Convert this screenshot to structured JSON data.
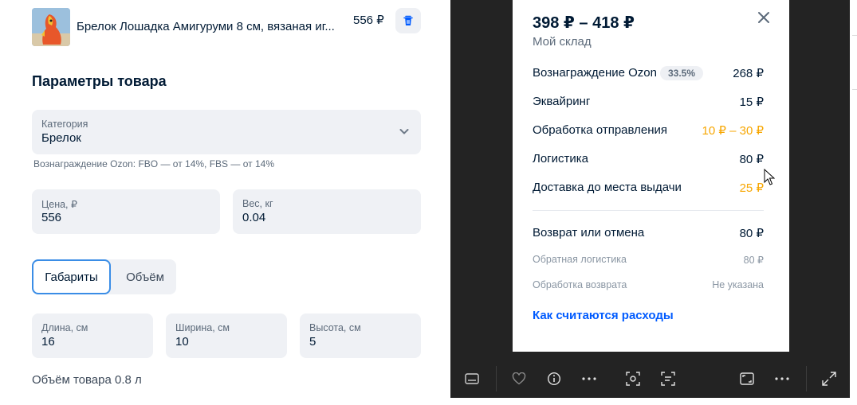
{
  "product": {
    "name": "Брелок Лошадка Амигуруми 8 см, вязаная иг...",
    "price": "556 ₽"
  },
  "section_title": "Параметры товара",
  "category": {
    "label": "Категория",
    "value": "Брелок",
    "hint": "Вознаграждение Ozon: FBO — от 14%, FBS — от 14%"
  },
  "price_field": {
    "label": "Цена, ₽",
    "value": "556"
  },
  "weight_field": {
    "label": "Вес, кг",
    "value": "0.04"
  },
  "tabs": {
    "dimensions": "Габариты",
    "volume": "Объём",
    "active": "dimensions"
  },
  "length_field": {
    "label": "Длина, см",
    "value": "16"
  },
  "width_field": {
    "label": "Ширина, см",
    "value": "10"
  },
  "height_field": {
    "label": "Высота, см",
    "value": "5"
  },
  "volume_text": "Объём товара 0.8 л",
  "popup": {
    "price_range": "398 ₽ – 418 ₽",
    "subtitle": "Мой склад",
    "rows": [
      {
        "label": "Вознаграждение Ozon",
        "badge": "33.5%",
        "value": "268 ₽",
        "color": "#001a34"
      },
      {
        "label": "Эквайринг",
        "value": "15 ₽",
        "color": "#001a34"
      },
      {
        "label": "Обработка отправления",
        "value": "10 ₽ – 30 ₽",
        "color": "#f7a600"
      },
      {
        "label": "Логистика",
        "value": "80 ₽",
        "color": "#001a34"
      },
      {
        "label": "Доставка до места выдачи",
        "value": "25 ₽",
        "color": "#f7a600"
      }
    ],
    "return_row": {
      "label": "Возврат или отмена",
      "value": "80 ₽"
    },
    "sub_rows": [
      {
        "label": "Обратная логистика",
        "value": "80 ₽"
      },
      {
        "label": "Обработка возврата",
        "value": "Не указана"
      }
    ],
    "link": "Как считаются расходы"
  },
  "toolbar_icons": [
    "subtitles-icon",
    "heart-icon",
    "info-icon",
    "more-icon",
    "scan-icon",
    "text-scan-icon",
    "fit-screen-icon",
    "more-icon",
    "expand-icon"
  ],
  "colors": {
    "accent": "#005bff",
    "warning": "#f7a600",
    "focus_border": "#3a8de6",
    "field_bg": "#eff1f5"
  }
}
